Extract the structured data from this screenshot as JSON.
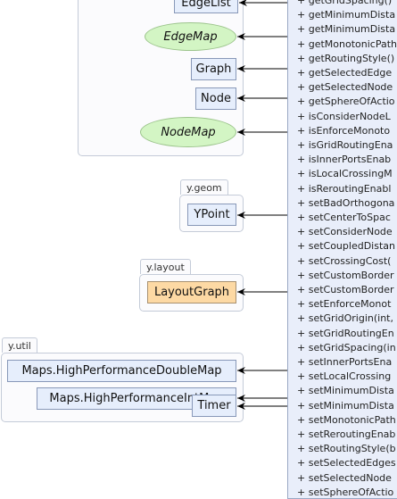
{
  "packages": [
    {
      "name": "",
      "classes": [
        "EdgeList",
        "Graph",
        "Node"
      ],
      "interfaces": [
        "EdgeMap",
        "NodeMap"
      ]
    },
    {
      "name": "y.geom",
      "classes": [
        "YPoint"
      ]
    },
    {
      "name": "y.layout",
      "classes": [
        "LayoutGraph"
      ]
    },
    {
      "name": "y.util",
      "classes": [
        "Maps.HighPerformanceDoubleMap",
        "Maps.HighPerformanceIntMap",
        "Timer"
      ]
    }
  ],
  "highlighted_class": "LayoutGraph",
  "methods": [
    "+ getGridSpacing()",
    "+ getMinimumDista",
    "+ getMinimumDista",
    "+ getMonotonicPath",
    "+ getRoutingStyle()",
    "+ getSelectedEdge",
    "+ getSelectedNode",
    "+ getSphereOfActio",
    "+ isConsiderNodeL",
    "+ isEnforceMonoto",
    "+ isGridRoutingEna",
    "+ isInnerPortsEnab",
    "+ isLocalCrossingM",
    "+ isReroutingEnabl",
    "+ setBadOrthogona",
    "+ setCenterToSpac",
    "+ setConsiderNode",
    "+ setCoupledDistan",
    "+ setCrossingCost(",
    "+ setCustomBorder",
    "+ setCustomBorder",
    "+ setEnforceMonot",
    "+ setGridOrigin(int,",
    "+ setGridRoutingEn",
    "+ setGridSpacing(in",
    "+ setInnerPortsEna",
    "+ setLocalCrossing",
    "+ setMinimumDista",
    "+ setMinimumDista",
    "+ setMonotonicPath",
    "+ setReroutingEnab",
    "+ setRoutingStyle(b",
    "+ setSelectedEdges",
    "+ setSelectedNode",
    "+ setSphereOfActio"
  ],
  "colors": {
    "class_fill": "#e6eefc",
    "interface_fill": "#d3f5c4",
    "highlight_fill": "#fdd9a4",
    "arrow": "#000000"
  }
}
